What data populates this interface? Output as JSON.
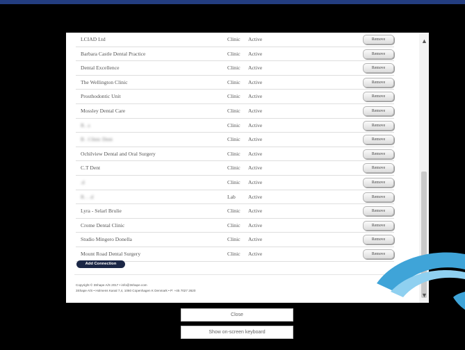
{
  "connections": [
    {
      "name": "LCIAD Ltd",
      "type": "Clinic",
      "status": "Active",
      "blurred": false
    },
    {
      "name": "Barbara Castle Dental Practice",
      "type": "Clinic",
      "status": "Active",
      "blurred": false
    },
    {
      "name": "Dental Excellence",
      "type": "Clinic",
      "status": "Active",
      "blurred": false
    },
    {
      "name": "The Wellington Clinic",
      "type": "Clinic",
      "status": "Active",
      "blurred": false
    },
    {
      "name": "Prosthodontic Unit",
      "type": "Clinic",
      "status": "Active",
      "blurred": false
    },
    {
      "name": "Mossley Dental Care",
      "type": "Clinic",
      "status": "Active",
      "blurred": false
    },
    {
      "name": "R.        .s",
      "type": "Clinic",
      "status": "Active",
      "blurred": true
    },
    {
      "name": "    B     .     Clinic Dent",
      "type": "Clinic",
      "status": "Active",
      "blurred": true
    },
    {
      "name": "Ochilview Dental and Oral Surgery",
      "type": "Clinic",
      "status": "Active",
      "blurred": false
    },
    {
      "name": "C.T Dent",
      "type": "Clinic",
      "status": "Active",
      "blurred": false
    },
    {
      "name": "          .d",
      "type": "Clinic",
      "status": "Active",
      "blurred": true
    },
    {
      "name": "R.    .    .d",
      "type": "Lab",
      "status": "Active",
      "blurred": true
    },
    {
      "name": "Lyra - Selarl Brulie",
      "type": "Clinic",
      "status": "Active",
      "blurred": false
    },
    {
      "name": "Crome Dental Clinic",
      "type": "Clinic",
      "status": "Active",
      "blurred": false
    },
    {
      "name": "Studio Mingero Donella",
      "type": "Clinic",
      "status": "Active",
      "blurred": false
    },
    {
      "name": "Mount Road Dental Surgery",
      "type": "Clinic",
      "status": "Active",
      "blurred": false
    }
  ],
  "remove_label": "Remove",
  "add_connection_label": "Add Connection",
  "footer": {
    "copyright": "Copyright © 3Shape A/S 2017 • info@3shape.com",
    "address": "3Shape A/S • Holmens Kanal 7,4, 1060 Copenhagen K Denmark • P: +45 7027 2620"
  },
  "close_label": "Close",
  "keyboard_label": "Show on-screen keyboard",
  "icons": {
    "scroll_up": "chevron-up-icon",
    "scroll_down": "chevron-down-icon",
    "brand": "3shape-swoosh-icon"
  },
  "colors": {
    "top_bar": "#233d80",
    "add_button": "#1b2746",
    "swoosh": "#3fa4d8"
  }
}
